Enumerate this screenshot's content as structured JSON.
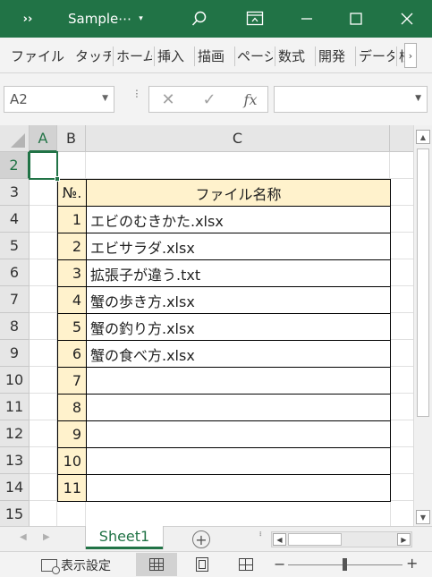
{
  "titlebar": {
    "title": "Sample⋯",
    "chevrons": "››",
    "caret": "▾",
    "icons": [
      "search-icon",
      "ribbon-display-icon",
      "minimize-icon",
      "maximize-icon",
      "close-icon"
    ],
    "background": "#217346"
  },
  "ribbon": {
    "tabs": [
      "ファイル",
      "タッチ",
      "ホーム",
      "挿入",
      "描画",
      "ページ",
      "数式",
      "開発",
      "データ",
      "校"
    ],
    "scroll_glyph": "›"
  },
  "formula_bar": {
    "name_box": "A2",
    "cancel_glyph": "✕",
    "enter_glyph": "✓",
    "fx_label": "fx",
    "formula_value": ""
  },
  "grid": {
    "columns": [
      "A",
      "B",
      "C"
    ],
    "selected_column": "A",
    "rows": [
      "2",
      "3",
      "4",
      "5",
      "6",
      "7",
      "8",
      "9",
      "10",
      "11",
      "12",
      "13",
      "14",
      "15"
    ],
    "selected_row": "2",
    "active_cell": "A2",
    "table": {
      "header_no": "№.",
      "header_name": "ファイル名称",
      "header_fill": "#fff2cc",
      "entries": [
        {
          "no": "1",
          "name": "エビのむきかた.xlsx"
        },
        {
          "no": "2",
          "name": "エビサラダ.xlsx"
        },
        {
          "no": "3",
          "name": "拡張子が違う.txt"
        },
        {
          "no": "4",
          "name": "蟹の歩き方.xlsx"
        },
        {
          "no": "5",
          "name": "蟹の釣り方.xlsx"
        },
        {
          "no": "6",
          "name": "蟹の食べ方.xlsx"
        },
        {
          "no": "7",
          "name": ""
        },
        {
          "no": "8",
          "name": ""
        },
        {
          "no": "9",
          "name": ""
        },
        {
          "no": "10",
          "name": ""
        },
        {
          "no": "11",
          "name": ""
        }
      ]
    }
  },
  "sheets": {
    "tabs": [
      "Sheet1"
    ],
    "active": "Sheet1",
    "add_glyph": "⊕"
  },
  "statusbar": {
    "display_settings": "表示設定",
    "views": [
      "normal-view-icon",
      "page-layout-view-icon",
      "page-break-view-icon"
    ],
    "active_view": "normal",
    "zoom_minus": "−",
    "zoom_plus": "+"
  }
}
